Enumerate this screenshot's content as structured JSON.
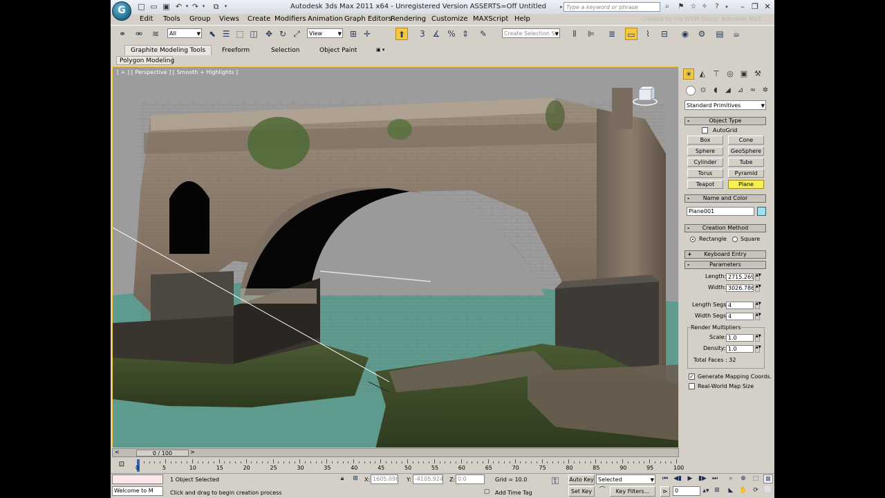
{
  "titlebar": {
    "title": "Autodesk 3ds Max  2011 x64  - Unregistered Version ASSERTS=Off   Untitled",
    "search_placeholder": "Type a keyword or phrase",
    "logo_letter": "G"
  },
  "menu": {
    "items": [
      "Edit",
      "Tools",
      "Group",
      "Views",
      "Create",
      "Modifiers",
      "Animation",
      "Graph Editors",
      "Rendering",
      "Customize",
      "MAXScript",
      "Help"
    ],
    "watermark": "Created by the WDM Group, Autodesk M&E"
  },
  "toolbar": {
    "selection_filter": "All",
    "ref_coord": "View",
    "named_selection_placeholder": "Create Selection Se",
    "snap_label": "3"
  },
  "ribbon": {
    "tabs": [
      "Graphite Modeling Tools",
      "Freeform",
      "Selection",
      "Object Paint"
    ],
    "active_sub": "Polygon Modeling"
  },
  "viewport": {
    "label": "[ + ] [ Perspective ] [ Smooth + Highlights ]"
  },
  "command_panel": {
    "category": "Standard Primitives",
    "object_type": {
      "title": "Object Type",
      "autogrid": "AutoGrid",
      "buttons": [
        "Box",
        "Cone",
        "Sphere",
        "GeoSphere",
        "Cylinder",
        "Tube",
        "Torus",
        "Pyramid",
        "Teapot",
        "Plane"
      ],
      "active": "Plane"
    },
    "name_and_color": {
      "title": "Name and Color",
      "name": "Plane001",
      "color": "#9fe3f0"
    },
    "creation_method": {
      "title": "Creation Method",
      "options": [
        "Rectangle",
        "Square"
      ],
      "selected": "Rectangle"
    },
    "keyboard_entry": {
      "title": "Keyboard Entry"
    },
    "parameters": {
      "title": "Parameters",
      "length_label": "Length:",
      "length": "2715.269",
      "width_label": "Width:",
      "width": "3026.786",
      "length_segs_label": "Length Segs:",
      "length_segs": "4",
      "width_segs_label": "Width Segs:",
      "width_segs": "4",
      "render_mult_label": "Render Multipliers",
      "scale_label": "Scale:",
      "scale": "1.0",
      "density_label": "Density:",
      "density": "1.0",
      "total_faces": "Total Faces : 32",
      "gen_mapping": "Generate Mapping Coords.",
      "real_world": "Real-World Map Size"
    }
  },
  "timeline": {
    "frame": "0 / 100",
    "ticks": [
      0,
      5,
      10,
      15,
      20,
      25,
      30,
      35,
      40,
      45,
      50,
      55,
      60,
      65,
      70,
      75,
      80,
      85,
      90,
      95,
      100
    ]
  },
  "status": {
    "maxscript": "Welcome to M",
    "selected": "1 Object Selected",
    "prompt": "Click and drag to begin creation process",
    "x_label": "X:",
    "x": "1605.098",
    "y_label": "Y:",
    "y": "-4105.924",
    "z_label": "Z:",
    "z": "0.0",
    "grid": "Grid = 10.0",
    "add_time_tag": "Add Time Tag",
    "auto_key": "Auto Key",
    "set_key": "Set Key",
    "key_mode": "Selected",
    "key_filters": "Key Filters...",
    "current_frame": "0"
  }
}
